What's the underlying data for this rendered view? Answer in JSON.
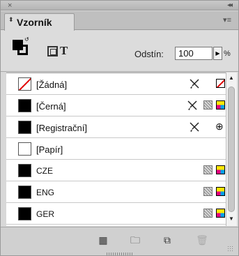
{
  "panel": {
    "close_glyph": "×",
    "collapse_glyph": "◂◂",
    "tab_label": "Vzorník",
    "tab_arrows_glyph": "⬍",
    "menu_glyph": "▾≡"
  },
  "controls": {
    "format_text_glyph": "T",
    "tint_label": "Odstín:",
    "tint_value": "100",
    "tint_arrow_glyph": "▶",
    "tint_unit": "%"
  },
  "swatches": [
    {
      "name": "[Žádná]",
      "swatch": "none",
      "icons": [
        "pencil-crossed",
        "none"
      ]
    },
    {
      "name": "[Černá]",
      "swatch": "black",
      "icons": [
        "pencil-crossed",
        "process",
        "cmyk"
      ]
    },
    {
      "name": "[Registrační]",
      "swatch": "black",
      "icons": [
        "pencil-crossed",
        "registration"
      ]
    },
    {
      "name": "[Papír]",
      "swatch": "white",
      "icons": []
    },
    {
      "name": "CZE",
      "swatch": "black",
      "icons": [
        "process",
        "cmyk"
      ]
    },
    {
      "name": "ENG",
      "swatch": "black",
      "icons": [
        "process",
        "cmyk"
      ]
    },
    {
      "name": "GER",
      "swatch": "black",
      "icons": [
        "process",
        "cmyk"
      ]
    }
  ],
  "registration_glyph": "⊕",
  "bottom": {
    "show_kinds_glyph": "▦",
    "new_group_glyph": "🗀",
    "new_swatch_glyph": "⧉",
    "delete_glyph": "🗑"
  },
  "colors": {
    "none_red": "#e00000",
    "cyan": "#00a0e9",
    "magenta": "#e4007f",
    "yellow": "#ffe600"
  }
}
